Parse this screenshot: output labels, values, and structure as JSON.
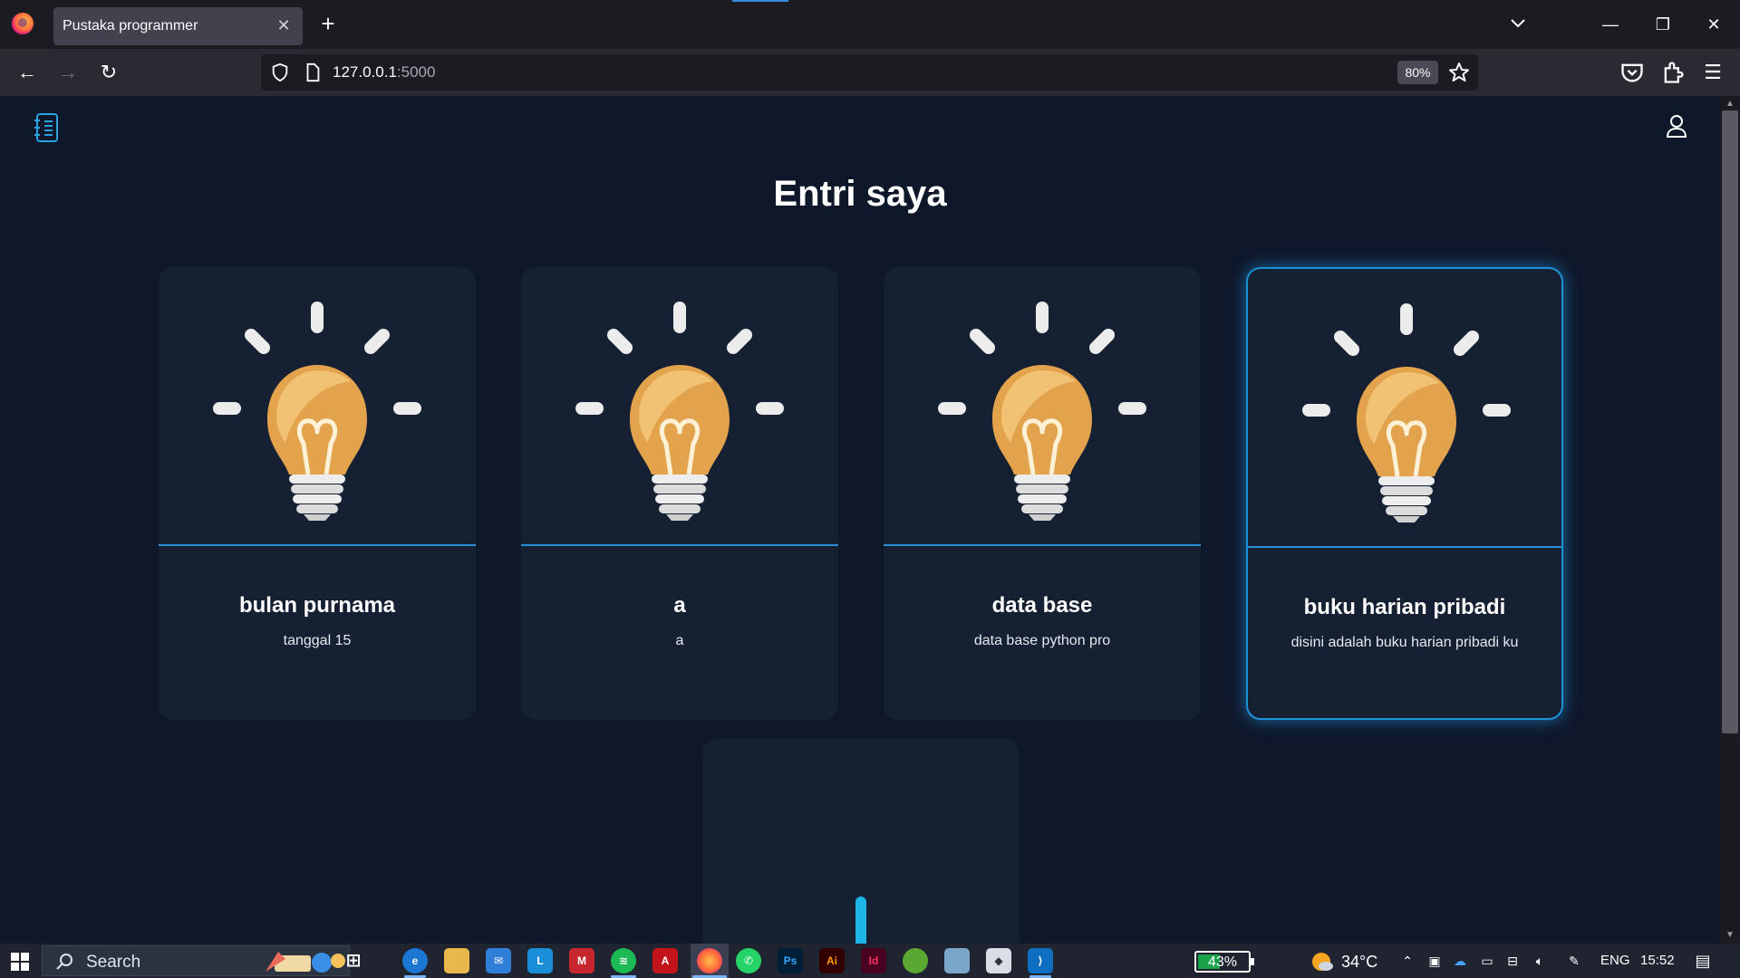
{
  "browser": {
    "tab_title": "Pustaka programmer",
    "url_host": "127.0.0.1",
    "url_port": ":5000",
    "zoom": "80%"
  },
  "page": {
    "title": "Entri saya",
    "cards": [
      {
        "title": "bulan purnama",
        "description": "tanggal 15"
      },
      {
        "title": "a",
        "description": "a"
      },
      {
        "title": "data base",
        "description": "data base python pro"
      },
      {
        "title": "buku harian pribadi",
        "description": "disini adalah buku harian pribadi ku"
      }
    ]
  },
  "taskbar": {
    "search_label": "Search",
    "battery": "43%",
    "temperature": "34°C",
    "language": "ENG",
    "time": "15:52"
  },
  "colors": {
    "page_bg": "#0f172a",
    "card_bg": "#162033",
    "accent": "#1e90d6"
  }
}
